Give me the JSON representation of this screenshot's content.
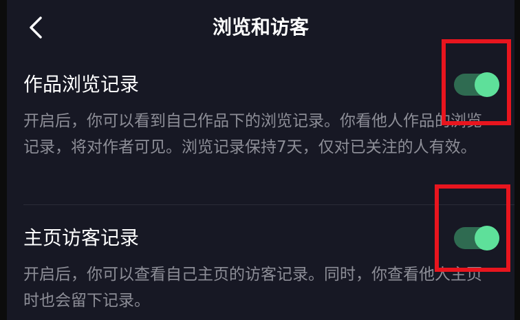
{
  "header": {
    "back_icon": "chevron-left-icon",
    "title": "浏览和访客"
  },
  "settings": [
    {
      "title": "作品浏览记录",
      "description": "开启后，你可以看到自己作品下的浏览记录。你看他人作品的浏览记录，将对作者可见。浏览记录保持7天，仅对已关注的人有效。",
      "enabled": true
    },
    {
      "title": "主页访客记录",
      "description": "开启后，你可以查看自己主页的访客记录。同时，你查看他人主页时也会留下记录。",
      "enabled": true
    }
  ],
  "colors": {
    "background": "#171824",
    "toggle_track_on": "#2f6b51",
    "toggle_knob_on": "#5ee09a",
    "highlight_box": "#e8151e"
  }
}
